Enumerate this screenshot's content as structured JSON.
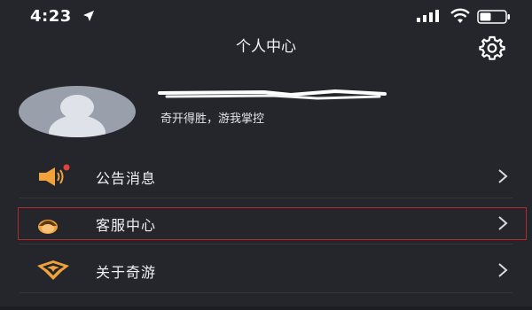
{
  "status_bar": {
    "time": "4:23"
  },
  "nav": {
    "title": "个人中心"
  },
  "profile": {
    "slogan": "奇开得胜，游我掌控"
  },
  "menu": {
    "items": [
      {
        "label": "公告消息",
        "icon": "speaker-icon",
        "has_badge": true
      },
      {
        "label": "客服中心",
        "icon": "service-agent-icon",
        "highlighted": true
      },
      {
        "label": "关于奇游",
        "icon": "game-logo-icon"
      }
    ]
  },
  "colors": {
    "background": "#24262c",
    "accent_orange": "#f0a23b",
    "badge_red": "#e0413a",
    "highlight_border": "#b5282b"
  }
}
